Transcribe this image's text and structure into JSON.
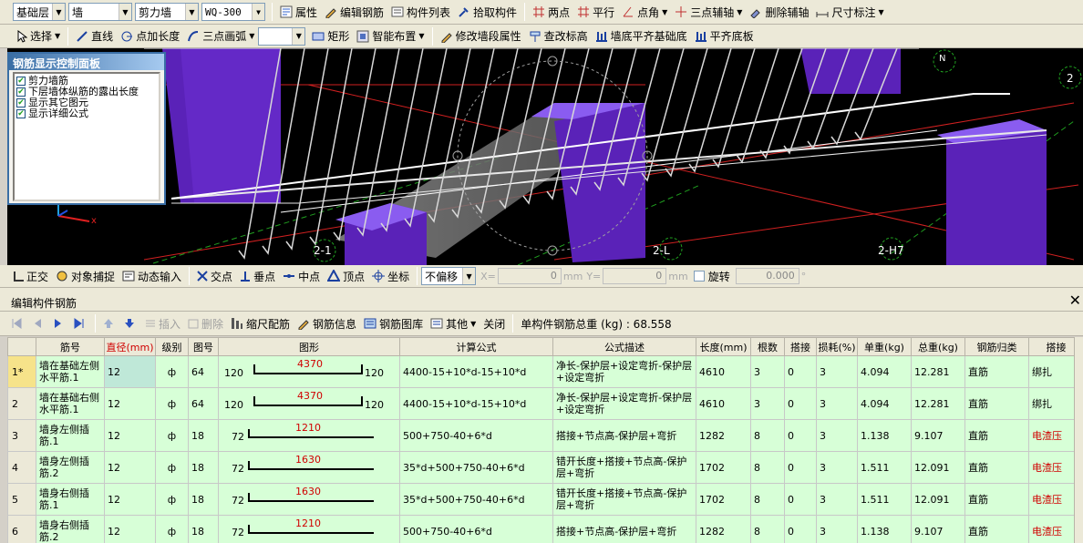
{
  "toolbar1": {
    "floor": "基础层",
    "type": "墙",
    "subtype": "剪力墙",
    "member": "WQ-300",
    "buttons": [
      "属性",
      "编辑钢筋",
      "构件列表",
      "拾取构件",
      "两点",
      "平行",
      "点角",
      "三点辅轴",
      "删除辅轴",
      "尺寸标注"
    ]
  },
  "toolbar2": {
    "select": "选择",
    "line": "直线",
    "point_length": "点加长度",
    "arc": "三点画弧",
    "rect": "矩形",
    "smart": "智能布置",
    "modify_seg": "修改墙段属性",
    "check_elev": "查改标高",
    "align_base": "墙底平齐基础底",
    "align_bottom": "平齐底板"
  },
  "panel": {
    "title": "钢筋显示控制面板",
    "items": [
      "剪力墙筋",
      "下层墙体纵筋的露出长度",
      "显示其它图元",
      "显示详细公式"
    ]
  },
  "viewport": {
    "labels": [
      "2-1",
      "2-L",
      "2-H7",
      "2",
      "N"
    ]
  },
  "snapbar": {
    "ortho": "正交",
    "snap": "对象捕捉",
    "dynamic": "动态输入",
    "intersection": "交点",
    "perpendicular": "垂点",
    "midpoint": "中点",
    "vertex": "顶点",
    "coord": "坐标",
    "offset": "不偏移",
    "x_label": "X=",
    "x_value": "0",
    "y_label": "Y=",
    "y_value": "0",
    "unit": "mm",
    "rotate": "旋转",
    "rotate_value": "0.000",
    "degree": "°"
  },
  "editor": {
    "title": "编辑构件钢筋",
    "insert": "插入",
    "delete": "删除",
    "scale": "缩尺配筋",
    "info": "钢筋信息",
    "library": "钢筋图库",
    "other": "其他",
    "close": "关闭",
    "total": "单构件钢筋总重 (kg) : 68.558"
  },
  "table": {
    "headers": [
      "",
      "筋号",
      "直径(mm)",
      "级别",
      "图号",
      "图形",
      "计算公式",
      "公式描述",
      "长度(mm)",
      "根数",
      "搭接",
      "损耗(%)",
      "单重(kg)",
      "总重(kg)",
      "钢筋归类",
      "搭接"
    ],
    "rows": [
      {
        "rn": "1*",
        "name": "墙在基础左侧水平筋.1",
        "dia": "12",
        "grade": "ф",
        "fig": "64",
        "sl": "120",
        "sv": "4370",
        "sr": "120",
        "formula": "4400-15+10*d-15+10*d",
        "desc": "净长-保护层+设定弯折-保护层+设定弯折",
        "len": "4610",
        "cnt": "3",
        "lap": "0",
        "loss": "3",
        "unit": "4.094",
        "total": "12.281",
        "cat": "直筋",
        "lt": "绑扎"
      },
      {
        "rn": "2",
        "name": "墙在基础右侧水平筋.1",
        "dia": "12",
        "grade": "ф",
        "fig": "64",
        "sl": "120",
        "sv": "4370",
        "sr": "120",
        "formula": "4400-15+10*d-15+10*d",
        "desc": "净长-保护层+设定弯折-保护层+设定弯折",
        "len": "4610",
        "cnt": "3",
        "lap": "0",
        "loss": "3",
        "unit": "4.094",
        "total": "12.281",
        "cat": "直筋",
        "lt": "绑扎"
      },
      {
        "rn": "3",
        "name": "墙身左侧插筋.1",
        "dia": "12",
        "grade": "ф",
        "fig": "18",
        "sl": "72",
        "sv": "1210",
        "sr": "",
        "formula": "500+750-40+6*d",
        "desc": "搭接+节点高-保护层+弯折",
        "len": "1282",
        "cnt": "8",
        "lap": "0",
        "loss": "3",
        "unit": "1.138",
        "total": "9.107",
        "cat": "直筋",
        "lt": "电渣压"
      },
      {
        "rn": "4",
        "name": "墙身左侧插筋.2",
        "dia": "12",
        "grade": "ф",
        "fig": "18",
        "sl": "72",
        "sv": "1630",
        "sr": "",
        "formula": "35*d+500+750-40+6*d",
        "desc": "错开长度+搭接+节点高-保护层+弯折",
        "len": "1702",
        "cnt": "8",
        "lap": "0",
        "loss": "3",
        "unit": "1.511",
        "total": "12.091",
        "cat": "直筋",
        "lt": "电渣压"
      },
      {
        "rn": "5",
        "name": "墙身右侧插筋.1",
        "dia": "12",
        "grade": "ф",
        "fig": "18",
        "sl": "72",
        "sv": "1630",
        "sr": "",
        "formula": "35*d+500+750-40+6*d",
        "desc": "错开长度+搭接+节点高-保护层+弯折",
        "len": "1702",
        "cnt": "8",
        "lap": "0",
        "loss": "3",
        "unit": "1.511",
        "total": "12.091",
        "cat": "直筋",
        "lt": "电渣压"
      },
      {
        "rn": "6",
        "name": "墙身右侧插筋.2",
        "dia": "12",
        "grade": "ф",
        "fig": "18",
        "sl": "72",
        "sv": "1210",
        "sr": "",
        "formula": "500+750-40+6*d",
        "desc": "搭接+节点高-保护层+弯折",
        "len": "1282",
        "cnt": "8",
        "lap": "0",
        "loss": "3",
        "unit": "1.138",
        "total": "9.107",
        "cat": "直筋",
        "lt": "电渣压"
      }
    ]
  }
}
